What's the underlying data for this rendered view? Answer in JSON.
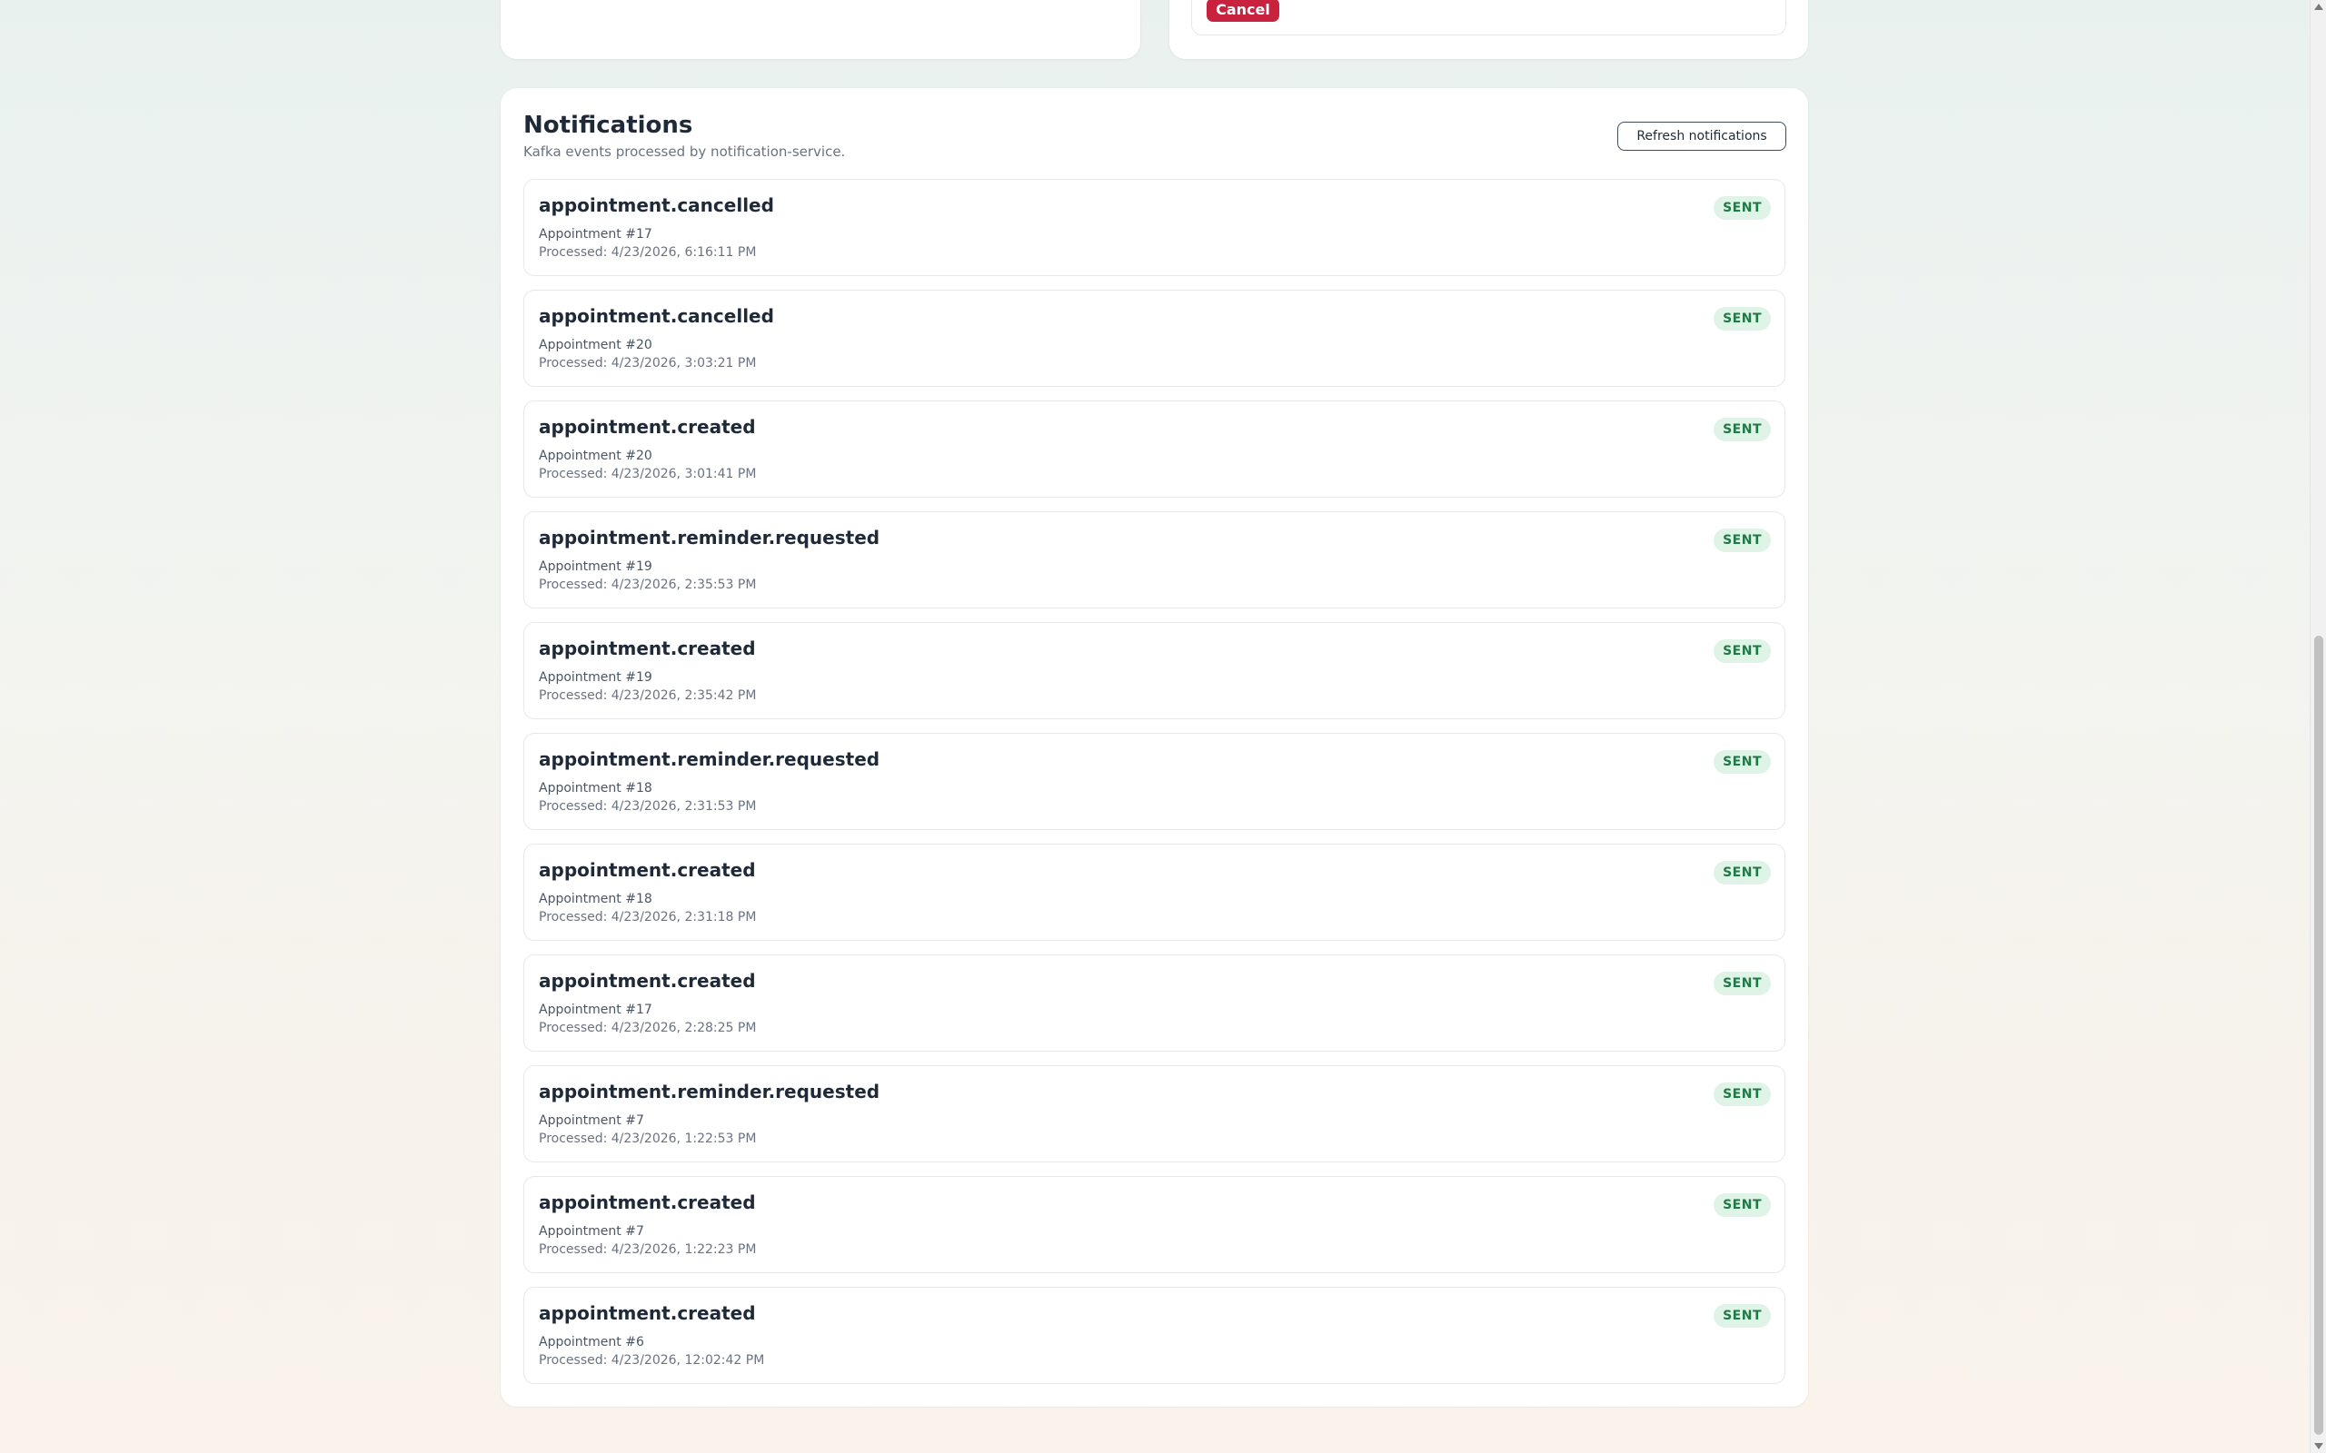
{
  "top_left_panel": {},
  "top_right_panel": {
    "cancel_label": "Cancel"
  },
  "notifications": {
    "title": "Notifications",
    "subtitle": "Kafka events processed by notification-service.",
    "refresh_label": "Refresh notifications",
    "items": [
      {
        "event": "appointment.cancelled",
        "appointment": "Appointment #17",
        "processed": "Processed: 4/23/2026, 6:16:11 PM",
        "status": "SENT"
      },
      {
        "event": "appointment.cancelled",
        "appointment": "Appointment #20",
        "processed": "Processed: 4/23/2026, 3:03:21 PM",
        "status": "SENT"
      },
      {
        "event": "appointment.created",
        "appointment": "Appointment #20",
        "processed": "Processed: 4/23/2026, 3:01:41 PM",
        "status": "SENT"
      },
      {
        "event": "appointment.reminder.requested",
        "appointment": "Appointment #19",
        "processed": "Processed: 4/23/2026, 2:35:53 PM",
        "status": "SENT"
      },
      {
        "event": "appointment.created",
        "appointment": "Appointment #19",
        "processed": "Processed: 4/23/2026, 2:35:42 PM",
        "status": "SENT"
      },
      {
        "event": "appointment.reminder.requested",
        "appointment": "Appointment #18",
        "processed": "Processed: 4/23/2026, 2:31:53 PM",
        "status": "SENT"
      },
      {
        "event": "appointment.created",
        "appointment": "Appointment #18",
        "processed": "Processed: 4/23/2026, 2:31:18 PM",
        "status": "SENT"
      },
      {
        "event": "appointment.created",
        "appointment": "Appointment #17",
        "processed": "Processed: 4/23/2026, 2:28:25 PM",
        "status": "SENT"
      },
      {
        "event": "appointment.reminder.requested",
        "appointment": "Appointment #7",
        "processed": "Processed: 4/23/2026, 1:22:53 PM",
        "status": "SENT"
      },
      {
        "event": "appointment.created",
        "appointment": "Appointment #7",
        "processed": "Processed: 4/23/2026, 1:22:23 PM",
        "status": "SENT"
      },
      {
        "event": "appointment.created",
        "appointment": "Appointment #6",
        "processed": "Processed: 4/23/2026, 12:02:42 PM",
        "status": "SENT"
      }
    ]
  },
  "colors": {
    "cancel_button": "#c8223f",
    "status_badge_bg": "#dff3e7",
    "status_badge_text": "#1f7a47"
  },
  "icons": {
    "scroll_up": "scroll-up-arrow-icon",
    "scroll_down": "scroll-down-arrow-icon"
  }
}
